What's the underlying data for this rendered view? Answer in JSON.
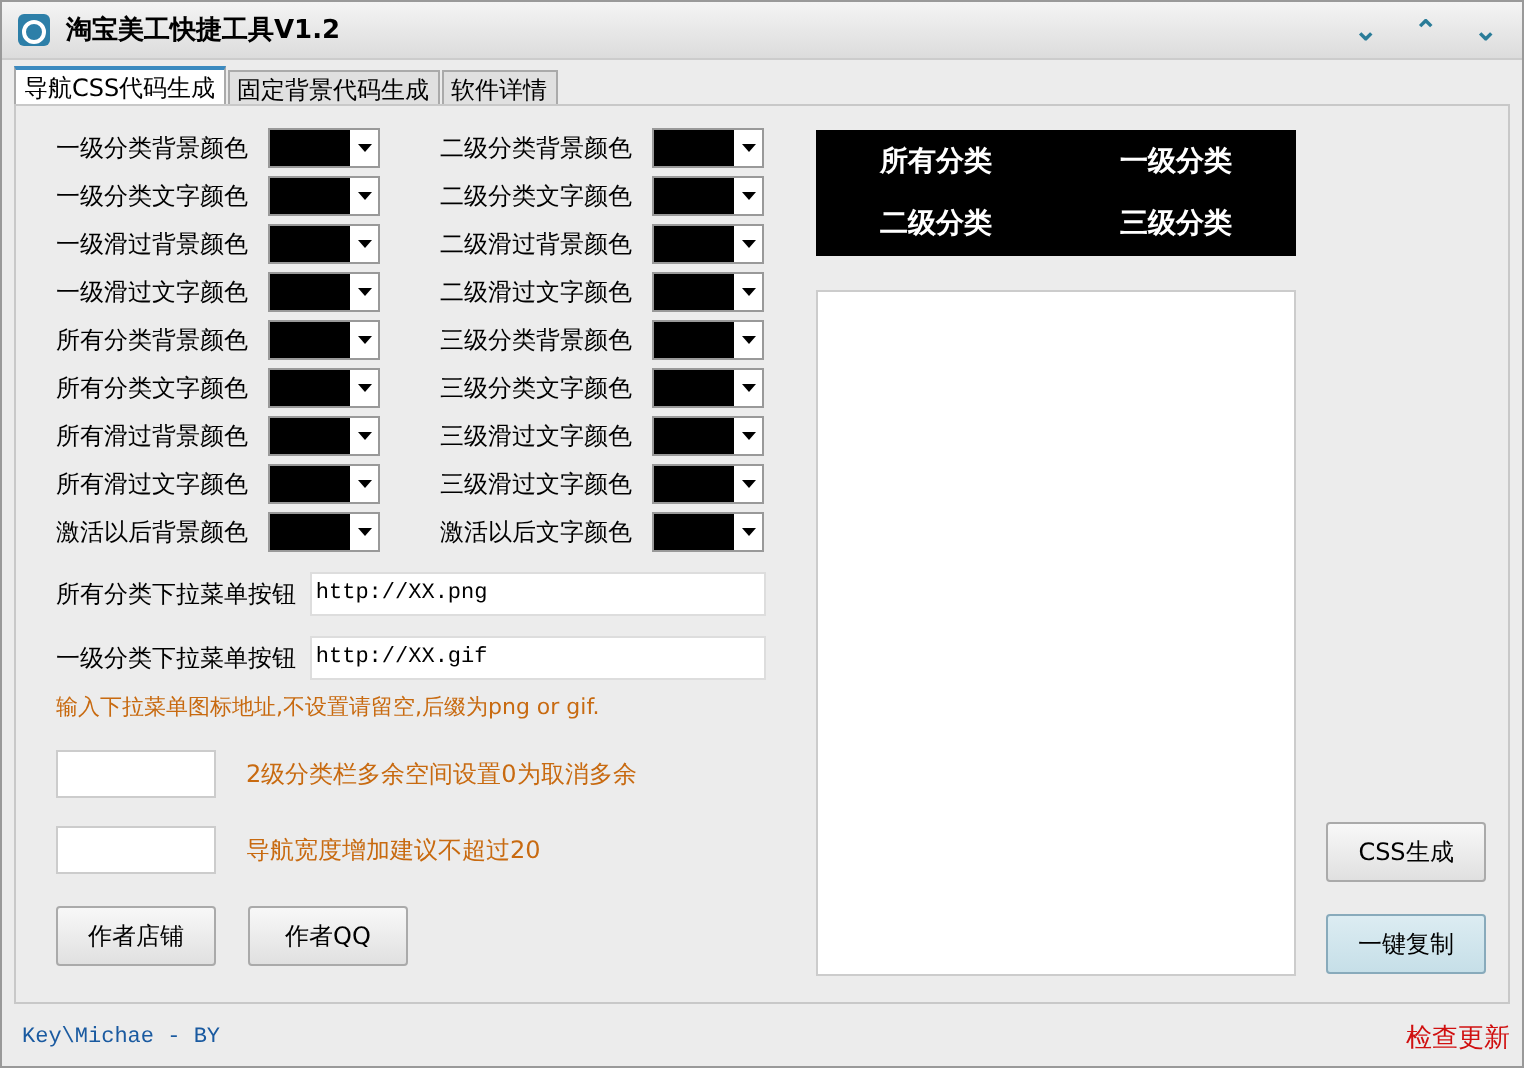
{
  "window": {
    "title": "淘宝美工快捷工具V1.2",
    "controls": [
      "⌄",
      "⌃",
      "⌄"
    ]
  },
  "tabs": [
    {
      "label": "导航CSS代码生成",
      "selected": true
    },
    {
      "label": "固定背景代码生成",
      "selected": false
    },
    {
      "label": "软件详情",
      "selected": false
    }
  ],
  "color_settings": [
    {
      "label": "一级分类背景颜色",
      "color": "#000000"
    },
    {
      "label": "二级分类背景颜色",
      "color": "#000000"
    },
    {
      "label": "一级分类文字颜色",
      "color": "#000000"
    },
    {
      "label": "二级分类文字颜色",
      "color": "#000000"
    },
    {
      "label": "一级滑过背景颜色",
      "color": "#000000"
    },
    {
      "label": "二级滑过背景颜色",
      "color": "#000000"
    },
    {
      "label": "一级滑过文字颜色",
      "color": "#000000"
    },
    {
      "label": "二级滑过文字颜色",
      "color": "#000000"
    },
    {
      "label": "所有分类背景颜色",
      "color": "#000000"
    },
    {
      "label": "三级分类背景颜色",
      "color": "#000000"
    },
    {
      "label": "所有分类文字颜色",
      "color": "#000000"
    },
    {
      "label": "三级分类文字颜色",
      "color": "#000000"
    },
    {
      "label": "所有滑过背景颜色",
      "color": "#000000"
    },
    {
      "label": "三级滑过文字颜色",
      "color": "#000000"
    },
    {
      "label": "所有滑过文字颜色",
      "color": "#000000"
    },
    {
      "label": "三级滑过文字颜色",
      "color": "#000000"
    },
    {
      "label": "激活以后背景颜色",
      "color": "#000000"
    },
    {
      "label": "激活以后文字颜色",
      "color": "#000000"
    }
  ],
  "url_fields": [
    {
      "label": "所有分类下拉菜单按钮",
      "value": "http://XX.png"
    },
    {
      "label": "一级分类下拉菜单按钮",
      "value": "http://XX.gif"
    }
  ],
  "hint": "输入下拉菜单图标地址,不设置请留空,后缀为png or gif.",
  "number_fields": [
    {
      "note": "2级分类栏多余空间设置0为取消多余"
    },
    {
      "note": "导航宽度增加建议不超过20"
    }
  ],
  "link_buttons": [
    "作者店铺",
    "作者QQ"
  ],
  "preview": [
    "所有分类",
    "一级分类",
    "二级分类",
    "三级分类"
  ],
  "actions": [
    {
      "label": "CSS生成",
      "selected": false
    },
    {
      "label": "一键复制",
      "selected": true
    }
  ],
  "status_bar": {
    "credit": "Key\\Michae - BY",
    "update_link": "检查更新"
  }
}
